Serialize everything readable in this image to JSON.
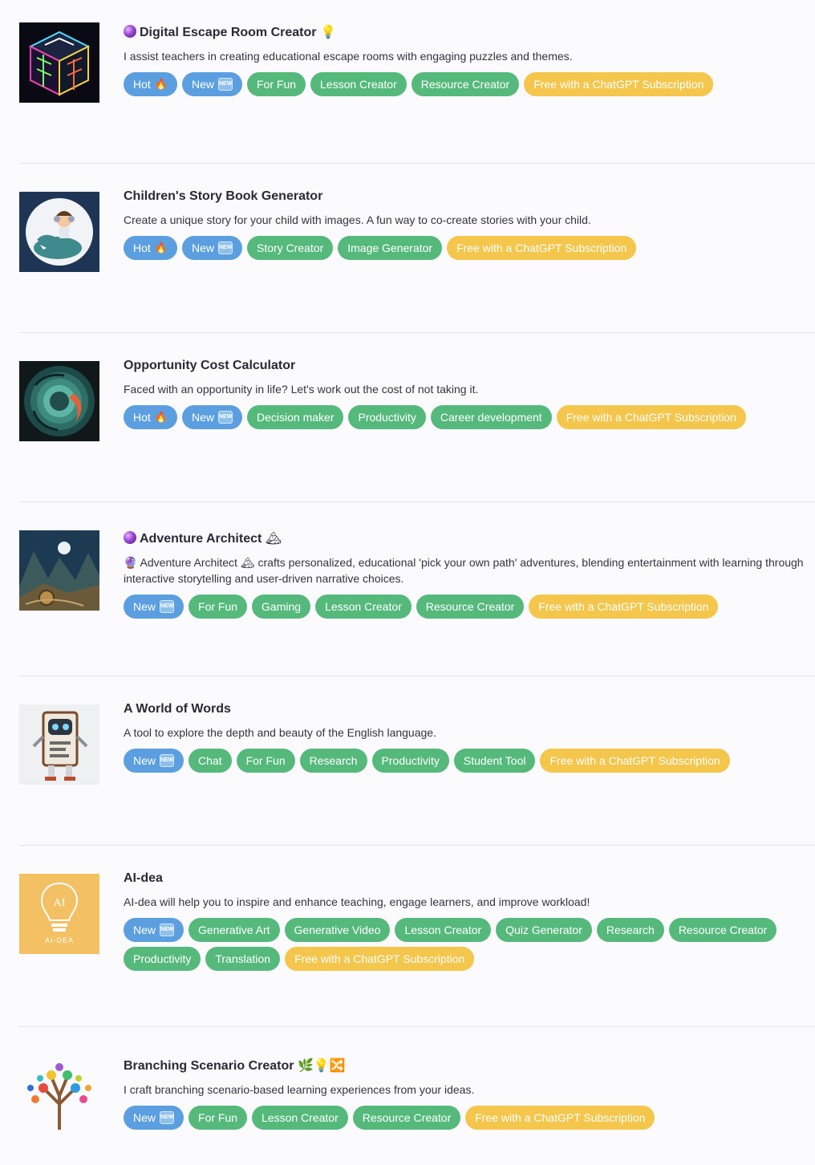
{
  "colors": {
    "hot_new": "#5b9fe0",
    "category": "#55b97c",
    "subscription": "#f4c64c",
    "background": "#fbfafd"
  },
  "items": [
    {
      "thumb_icon": "glowing-cube-icon",
      "title_prefix_icon": "crystal-ball-icon",
      "title": "Digital Escape Room Creator",
      "title_suffix": "💡",
      "description": "I assist teachers in creating educational escape rooms with engaging puzzles and themes.",
      "tags": [
        {
          "label": "Hot",
          "kind": "blue",
          "emoji": "🔥"
        },
        {
          "label": "New",
          "kind": "blue",
          "badge": "NEW"
        },
        {
          "label": "For Fun",
          "kind": "green"
        },
        {
          "label": "Lesson Creator",
          "kind": "green"
        },
        {
          "label": "Resource Creator",
          "kind": "green"
        },
        {
          "label": "Free with a ChatGPT Subscription",
          "kind": "yellow"
        }
      ]
    },
    {
      "thumb_icon": "child-on-dinosaur-icon",
      "title": "Children's Story Book Generator",
      "description": "Create a unique story for your child with images. A fun way to co-create stories with your child.",
      "tags": [
        {
          "label": "Hot",
          "kind": "blue",
          "emoji": "🔥"
        },
        {
          "label": "New",
          "kind": "blue",
          "badge": "NEW"
        },
        {
          "label": "Story Creator",
          "kind": "green"
        },
        {
          "label": "Image Generator",
          "kind": "green"
        },
        {
          "label": "Free with a ChatGPT Subscription",
          "kind": "yellow"
        }
      ]
    },
    {
      "thumb_icon": "teal-swirl-icon",
      "title": "Opportunity Cost Calculator",
      "description": "Faced with an opportunity in life? Let's work out the cost of not taking it.",
      "tags": [
        {
          "label": "Hot",
          "kind": "blue",
          "emoji": "🔥"
        },
        {
          "label": "New",
          "kind": "blue",
          "badge": "NEW"
        },
        {
          "label": "Decision maker",
          "kind": "green"
        },
        {
          "label": "Productivity",
          "kind": "green"
        },
        {
          "label": "Career development",
          "kind": "green"
        },
        {
          "label": "Free with a ChatGPT Subscription",
          "kind": "yellow"
        }
      ]
    },
    {
      "thumb_icon": "fantasy-landscape-icon",
      "title_prefix_icon": "crystal-ball-icon",
      "title": "Adventure Architect",
      "title_suffix": "🏔",
      "description": "🔮 Adventure Architect 🏔 crafts personalized, educational 'pick your own path' adventures, blending entertainment with learning through interactive storytelling and user-driven narrative choices.",
      "tags": [
        {
          "label": "New",
          "kind": "blue",
          "badge": "NEW"
        },
        {
          "label": "For Fun",
          "kind": "green"
        },
        {
          "label": "Gaming",
          "kind": "green"
        },
        {
          "label": "Lesson Creator",
          "kind": "green"
        },
        {
          "label": "Resource Creator",
          "kind": "green"
        },
        {
          "label": "Free with a ChatGPT Subscription",
          "kind": "yellow"
        }
      ]
    },
    {
      "thumb_icon": "robot-book-icon",
      "title": "A World of Words",
      "description": "A tool to explore the depth and beauty of the English language.",
      "tags": [
        {
          "label": "New",
          "kind": "blue",
          "badge": "NEW"
        },
        {
          "label": "Chat",
          "kind": "green"
        },
        {
          "label": "For Fun",
          "kind": "green"
        },
        {
          "label": "Research",
          "kind": "green"
        },
        {
          "label": "Productivity",
          "kind": "green"
        },
        {
          "label": "Student Tool",
          "kind": "green"
        },
        {
          "label": "Free with a ChatGPT Subscription",
          "kind": "yellow"
        }
      ]
    },
    {
      "thumb_icon": "lightbulb-logo-icon",
      "thumb_text": "AI-DEA",
      "title": "AI-dea",
      "description": "AI-dea will help you to inspire and enhance teaching, engage learners, and improve workload!",
      "tags": [
        {
          "label": "New",
          "kind": "blue",
          "badge": "NEW"
        },
        {
          "label": "Generative Art",
          "kind": "green"
        },
        {
          "label": "Generative Video",
          "kind": "green"
        },
        {
          "label": "Lesson Creator",
          "kind": "green"
        },
        {
          "label": "Quiz Generator",
          "kind": "green"
        },
        {
          "label": "Research",
          "kind": "green"
        },
        {
          "label": "Resource Creator",
          "kind": "green"
        },
        {
          "label": "Productivity",
          "kind": "green"
        },
        {
          "label": "Translation",
          "kind": "green"
        },
        {
          "label": "Free with a ChatGPT Subscription",
          "kind": "yellow"
        }
      ]
    },
    {
      "thumb_icon": "colorful-tree-icon",
      "title": "Branching Scenario Creator",
      "title_suffix": "🌿💡🔀",
      "description": "I craft branching scenario-based learning experiences from your ideas.",
      "tags": [
        {
          "label": "New",
          "kind": "blue",
          "badge": "NEW"
        },
        {
          "label": "For Fun",
          "kind": "green"
        },
        {
          "label": "Lesson Creator",
          "kind": "green"
        },
        {
          "label": "Resource Creator",
          "kind": "green"
        },
        {
          "label": "Free with a ChatGPT Subscription",
          "kind": "yellow"
        }
      ]
    }
  ]
}
